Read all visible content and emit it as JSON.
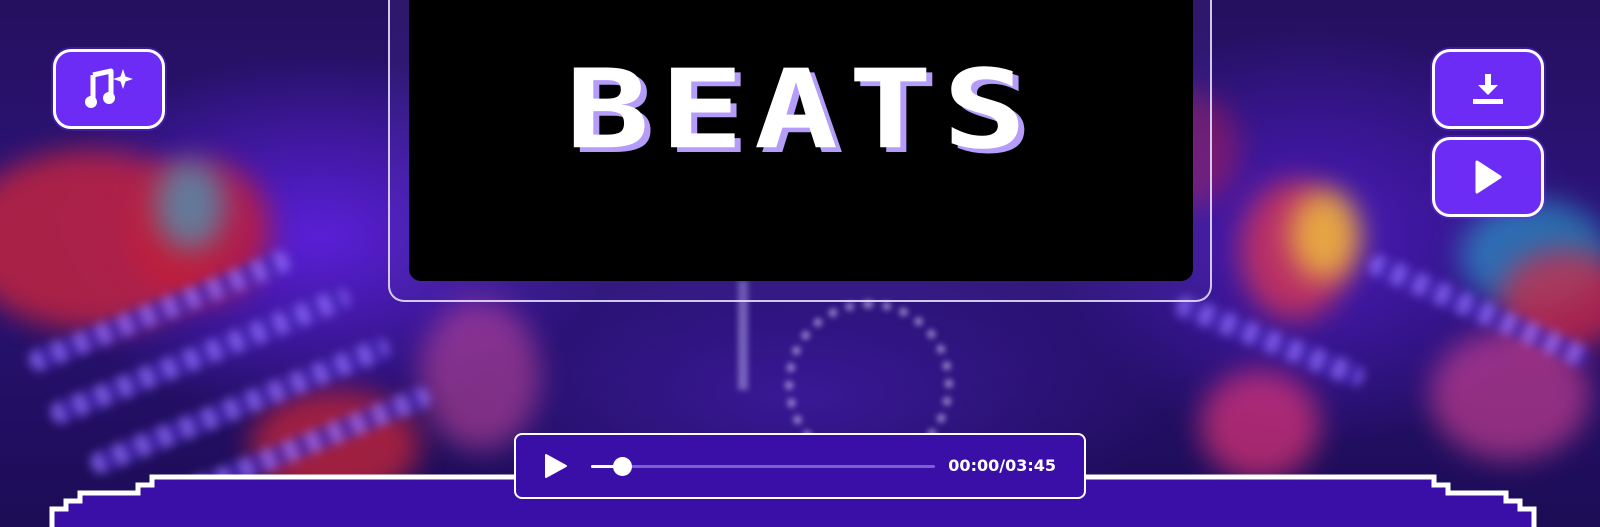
{
  "logo": {
    "text": "BEATS",
    "text_color": "#ffffff",
    "shadow_color": "#b49cf8",
    "panel_color": "#000000"
  },
  "buttons": {
    "music": {
      "icon": "music-sparkle-icon"
    },
    "download": {
      "icon": "download-icon"
    },
    "play": {
      "icon": "play-icon"
    },
    "fill_color": "#6d2cf5",
    "border_color": "#ffffff"
  },
  "player": {
    "time": "00:00/03:45",
    "progress_fraction": 0.09,
    "play_icon": "play-icon",
    "background_color": "#3a0fa8"
  },
  "colors": {
    "bottom_panel": "#3a0fa8",
    "bottom_border": "#ffffff"
  }
}
